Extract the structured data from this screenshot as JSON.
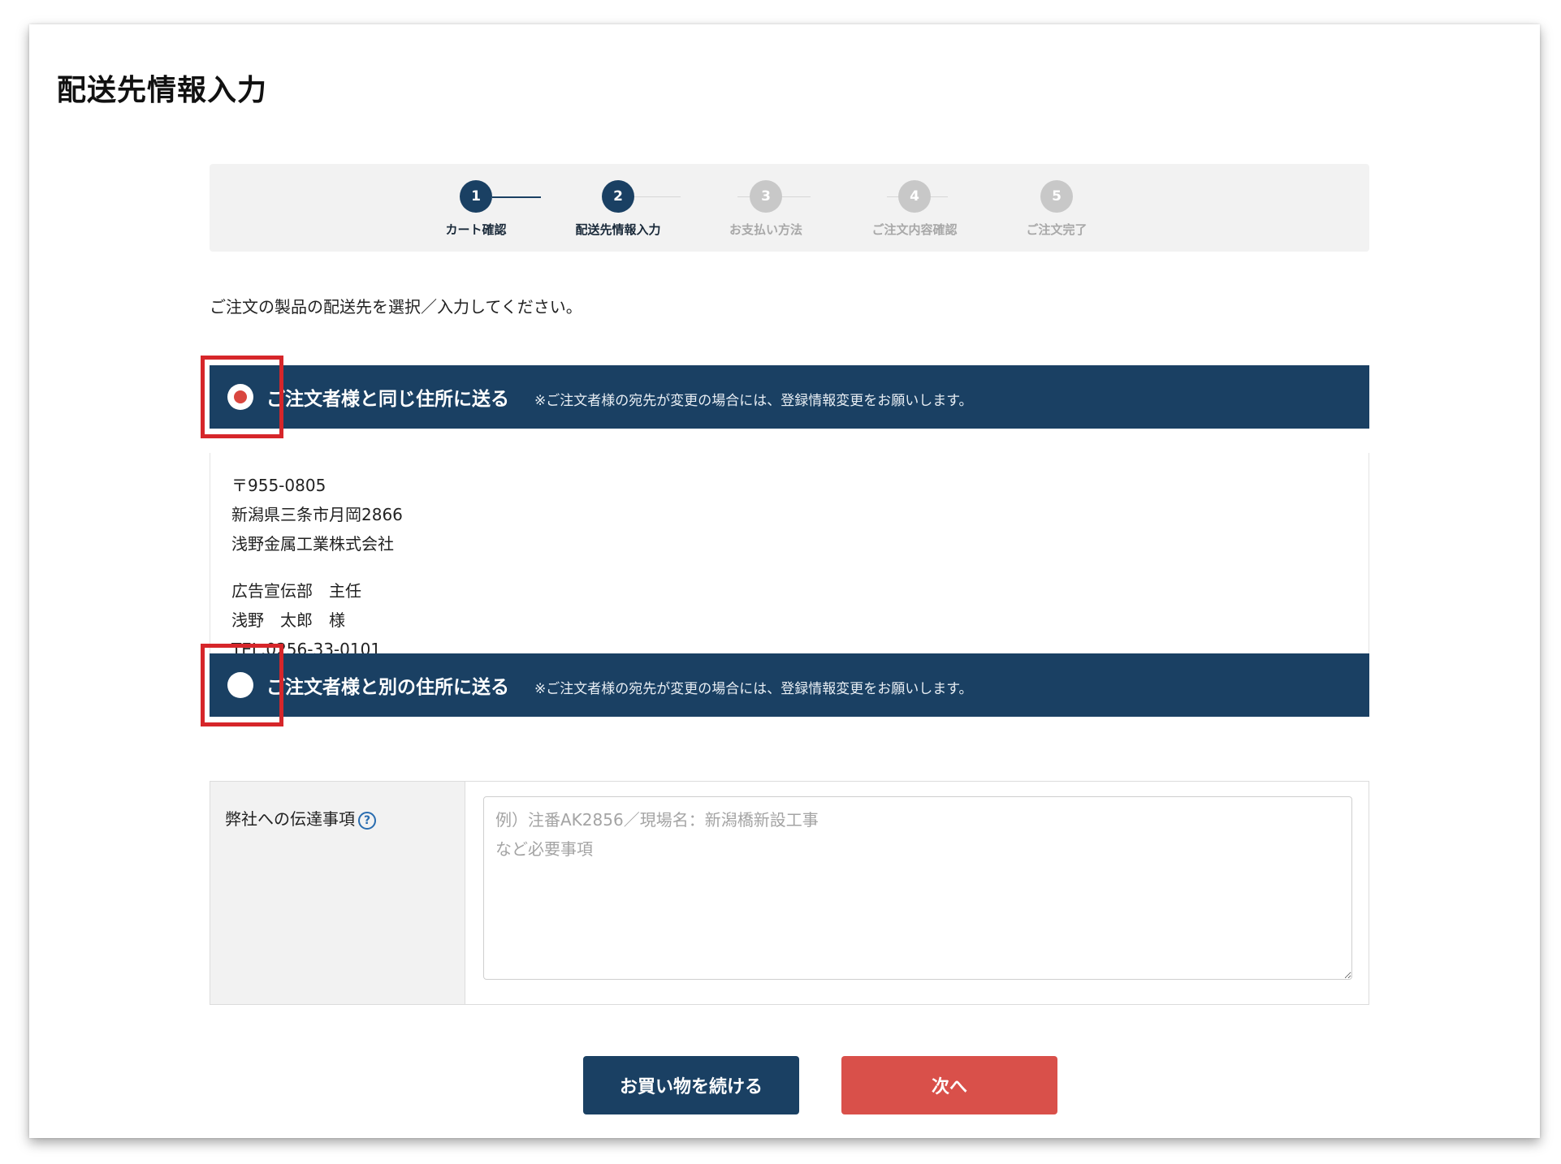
{
  "page": {
    "title": "配送先情報入力",
    "instruction": "ご注文の製品の配送先を選択／入力してください。"
  },
  "stepper": {
    "steps": [
      {
        "number": "1",
        "label": "カート確認",
        "state": "active"
      },
      {
        "number": "2",
        "label": "配送先情報入力",
        "state": "active"
      },
      {
        "number": "3",
        "label": "お支払い方法",
        "state": "inactive"
      },
      {
        "number": "4",
        "label": "ご注文内容確認",
        "state": "inactive"
      },
      {
        "number": "5",
        "label": "ご注文完了",
        "state": "inactive"
      }
    ]
  },
  "options": {
    "same_address": {
      "label": "ご注文者様と同じ住所に送る",
      "note": "※ご注文者様の宛先が変更の場合には、登録情報変更をお願いします。",
      "selected": true
    },
    "other_address": {
      "label": "ご注文者様と別の住所に送る",
      "note": "※ご注文者様の宛先が変更の場合には、登録情報変更をお願いします。",
      "selected": false
    }
  },
  "address": {
    "postal_code": "〒955-0805",
    "prefecture_city": "新潟県三条市月岡2866",
    "company": "浅野金属工業株式会社",
    "department_title": "広告宣伝部　主任",
    "name": "浅野　太郎　様",
    "tel": "TEL.0256-33-0101"
  },
  "message": {
    "label": "弊社への伝達事項",
    "help_icon": "question-circle-icon",
    "placeholder": "例）注番AK2856／現場名：新潟橋新設工事\nなど必要事項",
    "value": ""
  },
  "buttons": {
    "continue_shopping": "お買い物を続ける",
    "next": "次へ"
  },
  "colors": {
    "primary": "#1a4063",
    "accent": "#d9504a",
    "highlight": "#d6262a",
    "inactive_step": "#c8c8c8"
  }
}
